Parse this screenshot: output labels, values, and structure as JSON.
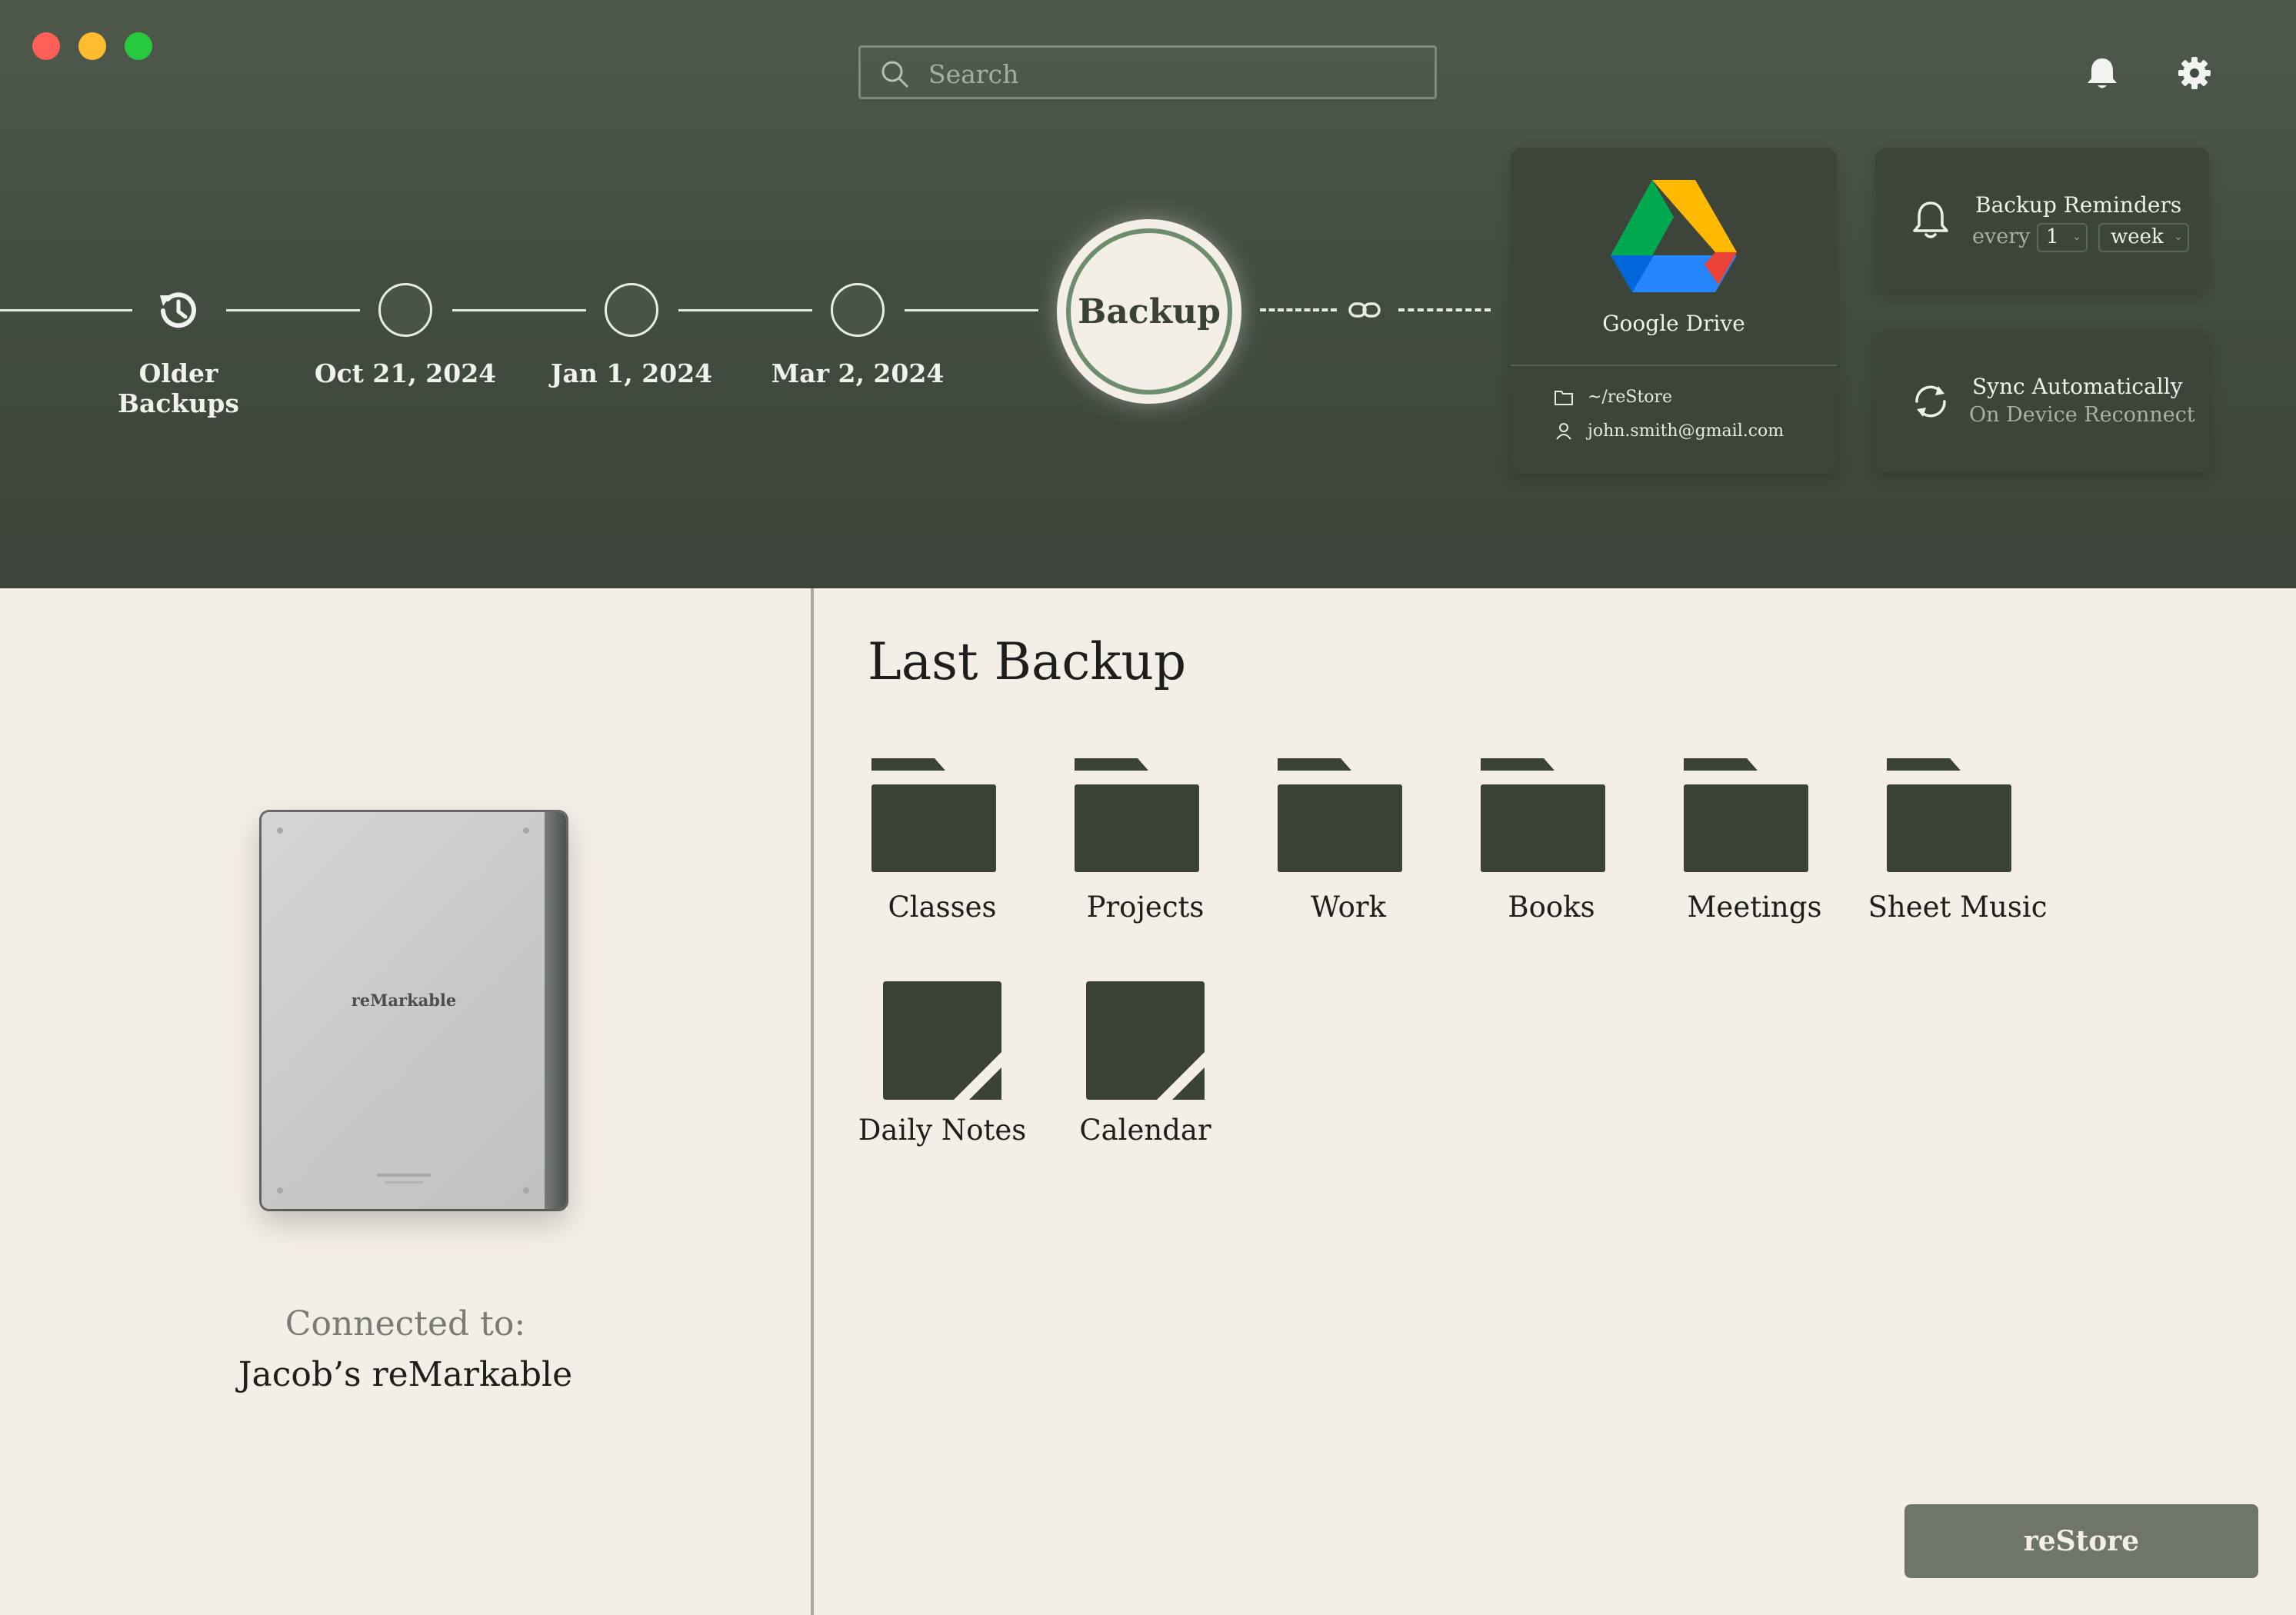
{
  "window": {
    "controls": [
      "close",
      "minimize",
      "maximize"
    ]
  },
  "search": {
    "placeholder": "Search",
    "value": ""
  },
  "header_icons": [
    "bell-icon",
    "gear-icon"
  ],
  "timeline": {
    "older_label": "Older Backups",
    "backups": [
      {
        "date": "Oct 21, 2024"
      },
      {
        "date": "Jan 1, 2024"
      },
      {
        "date": "Mar 2, 2024"
      }
    ],
    "backup_button": "Backup"
  },
  "destination": {
    "name": "Google Drive",
    "path": "~/reStore",
    "account": "john.smith@gmail.com"
  },
  "reminders": {
    "title": "Backup Reminders",
    "every_label": "every",
    "interval": "1",
    "unit": "week"
  },
  "sync": {
    "title": "Sync Automatically",
    "subtitle": "On Device Reconnect"
  },
  "device": {
    "brand": "reMarkable",
    "connected_label": "Connected to:",
    "name": "Jacob’s reMarkable"
  },
  "last_backup": {
    "title": "Last Backup",
    "folders": [
      "Classes",
      "Projects",
      "Work",
      "Books",
      "Meetings",
      "Sheet Music"
    ],
    "notebooks": [
      "Daily Notes",
      "Calendar"
    ]
  },
  "actions": {
    "restore_label": "reStore"
  },
  "colors": {
    "header": "#424b40",
    "panel_bg": "#f3eee6",
    "card": "#3d453b",
    "icon_fill": "#3b4339",
    "accent_ring": "#6e8c6e",
    "restore_button": "#6f756b"
  }
}
